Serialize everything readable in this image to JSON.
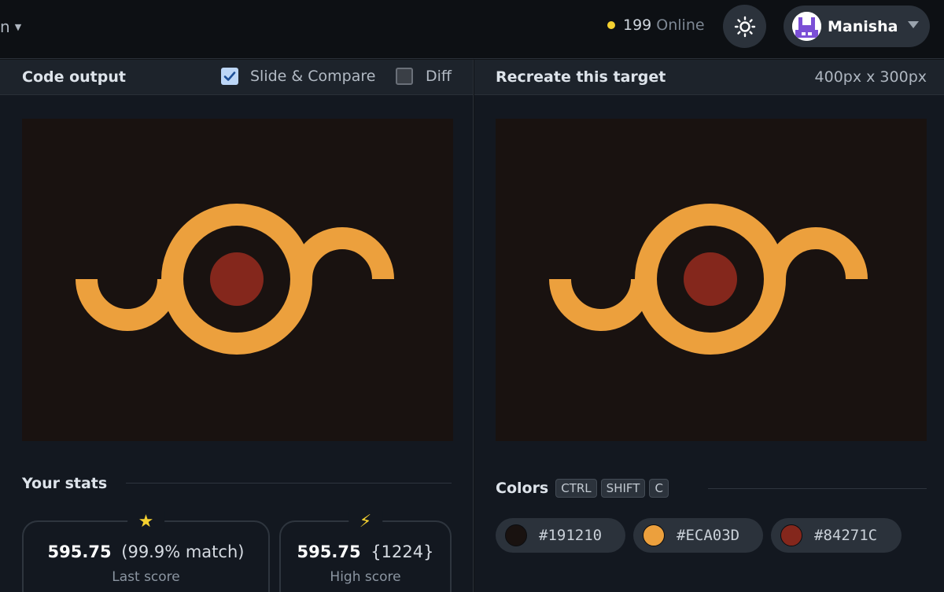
{
  "topbar": {
    "left_label": "n",
    "online_count": "199",
    "online_label": "Online",
    "username": "Manisha"
  },
  "left_panel": {
    "title": "Code output",
    "slide_compare_label": "Slide & Compare",
    "slide_compare_checked": true,
    "diff_label": "Diff",
    "diff_checked": false
  },
  "right_panel": {
    "title": "Recreate this target",
    "size_label": "400px x 300px"
  },
  "stats": {
    "title": "Your stats",
    "last": {
      "score": "595.75",
      "detail": "(99.9% match)",
      "label": "Last score",
      "icon": "star-icon"
    },
    "high": {
      "score": "595.75",
      "detail": "{1224}",
      "label": "High score",
      "icon": "lightning-icon"
    }
  },
  "colors_section": {
    "title": "Colors",
    "shortcut_keys": [
      "CTRL",
      "SHIFT",
      "C"
    ],
    "swatches": [
      {
        "hex": "#191210"
      },
      {
        "hex": "#ECA03D"
      },
      {
        "hex": "#84271C"
      }
    ]
  },
  "palette": {
    "background": "#191210",
    "stroke": "#ECA03D",
    "dot": "#84271C"
  }
}
